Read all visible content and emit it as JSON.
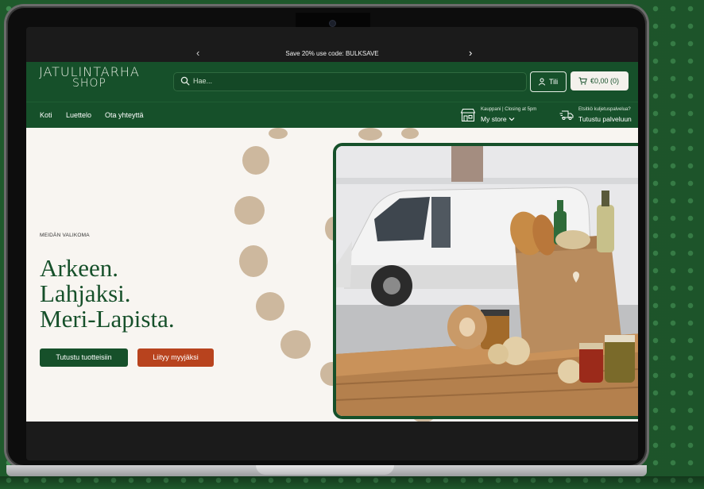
{
  "announcement": {
    "text": "Save 20% use code: BULKSAVE",
    "prev_icon": "chevron-left-icon",
    "next_icon": "chevron-right-icon"
  },
  "header": {
    "logo_line1": "JATULINTARHA",
    "logo_line2": "SHOP",
    "search_placeholder": "Hae...",
    "account_label": "Tili",
    "cart_label": "€0,00 (0)"
  },
  "nav": {
    "links": [
      "Koti",
      "Luettelo",
      "Ota yhteyttä"
    ],
    "store_small": "Kauppani | Closing at 5pm",
    "store_big": "My store",
    "service_small": "Etsitkö kuljetuspalvelua?",
    "service_big": "Tutustu palveluun"
  },
  "hero": {
    "eyebrow": "MEIDÄN VALIKOMA",
    "headline_1": "Arkeen.",
    "headline_2": "Lahjaksi.",
    "headline_3": "Meri-Lapista.",
    "primary_button": "Tutustu tuotteisiin",
    "secondary_button": "Liityy myyjäksi"
  },
  "colors": {
    "brand_green": "#16502a",
    "accent_orange": "#b8431e",
    "cream": "#f8f5f1",
    "dark": "#1b1b1b",
    "blob_tan": "#cdb89e"
  }
}
